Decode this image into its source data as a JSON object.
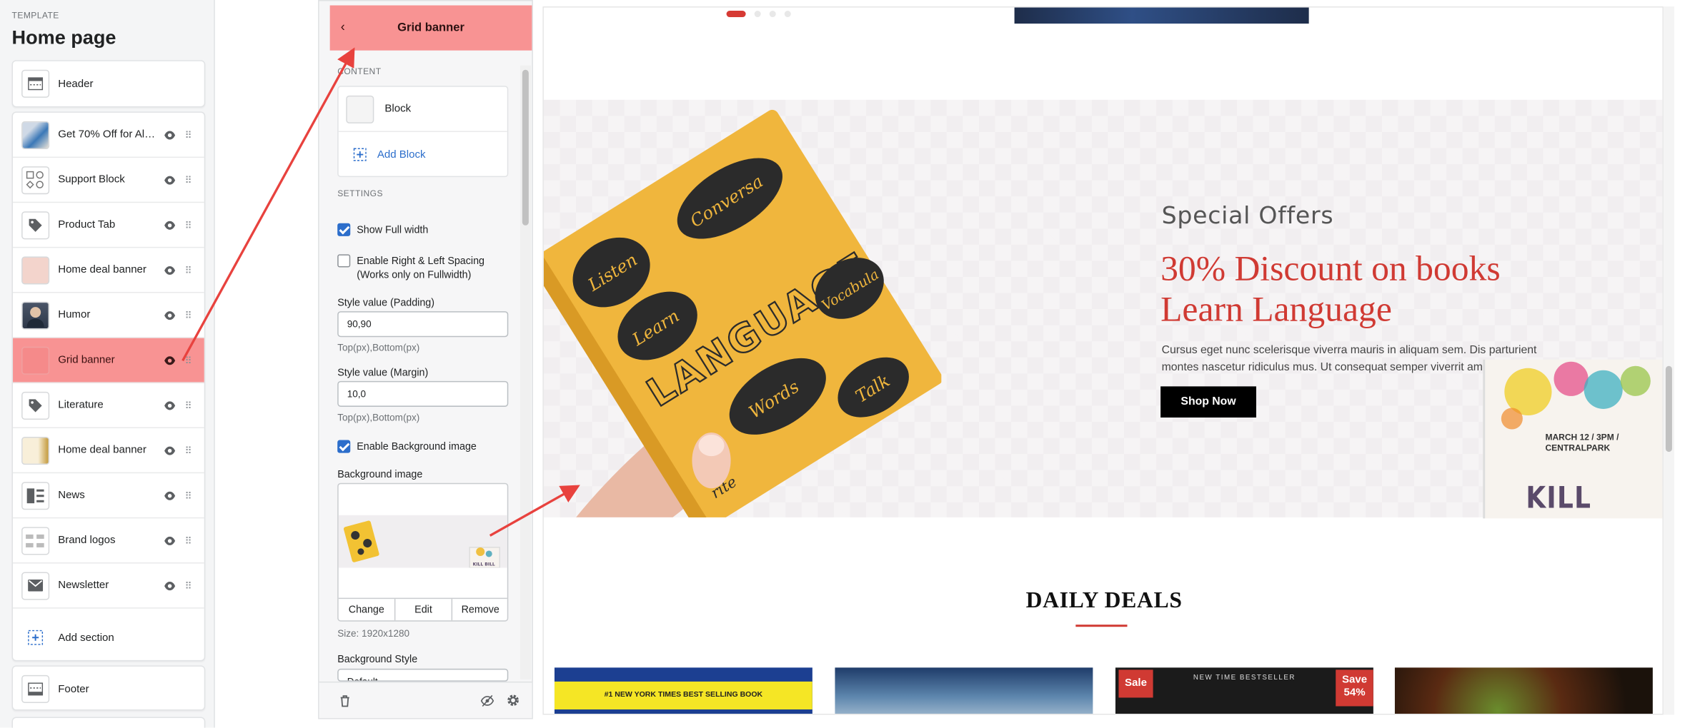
{
  "left_panel": {
    "template_label": "TEMPLATE",
    "page_title": "Home page",
    "header_label": "Header",
    "sections": [
      {
        "label": "Get 70% Off for All ...",
        "icon": "image-thumb"
      },
      {
        "label": "Support Block",
        "icon": "support-icons-thumb"
      },
      {
        "label": "Product Tab",
        "icon": "tag-icon"
      },
      {
        "label": "Home deal banner",
        "icon": "image-thumb"
      },
      {
        "label": "Humor",
        "icon": "portrait-thumb"
      },
      {
        "label": "Grid banner",
        "icon": "image-thumb",
        "active": true
      },
      {
        "label": "Literature",
        "icon": "tag-icon"
      },
      {
        "label": "Home deal banner",
        "icon": "image-thumb"
      },
      {
        "label": "News",
        "icon": "news-icon"
      },
      {
        "label": "Brand logos",
        "icon": "logos-thumb"
      },
      {
        "label": "Newsletter",
        "icon": "mail-icon"
      }
    ],
    "add_section_label": "Add section",
    "footer_label": "Footer"
  },
  "settings": {
    "title": "Grid banner",
    "content_caption": "CONTENT",
    "block_label": "Block",
    "add_block_label": "Add Block",
    "settings_caption": "SETTINGS",
    "show_full_width": {
      "label": "Show Full width",
      "checked": true
    },
    "enable_spacing": {
      "label_1": "Enable Right & Left Spacing",
      "label_2": "(Works only on Fullwidth)",
      "checked": false
    },
    "padding": {
      "label": "Style value (Padding)",
      "value": "90,90",
      "hint": "Top(px),Bottom(px)"
    },
    "margin": {
      "label": "Style value (Margin)",
      "value": "10,0",
      "hint": "Top(px),Bottom(px)"
    },
    "enable_bg": {
      "label": "Enable Background image",
      "checked": true
    },
    "bg_image_label": "Background image",
    "buttons": {
      "change": "Change",
      "edit": "Edit",
      "remove": "Remove"
    },
    "size_text": "Size: 1920x1280",
    "bg_style_label": "Background Style",
    "bg_style_value": "Default"
  },
  "preview": {
    "special_offers": "Special Offers",
    "headline_1": "30% Discount on books",
    "headline_2": "Learn Language",
    "paragraph": "Cursus eget nunc scelerisque viverra mauris in aliquam sem. Dis parturient montes nascetur ridiculus mus. Ut consequat semper viverrit amet",
    "shop_now": "Shop Now",
    "poster_date_1": "MARCH 12 / 3PM /",
    "poster_date_2": "CENTRALPARK",
    "poster_title": "KILL BILL",
    "book_title": "LANGUAGE",
    "bubble_words": [
      "Listen",
      "Conversa",
      "Learn",
      "Words",
      "Talk",
      "Vocabula",
      "rite"
    ],
    "daily_deals": "DAILY DEALS",
    "card1_text": "#1 NEW YORK TIMES BEST SELLING BOOK",
    "card3_text": "NEW TIME BESTSELLER",
    "sale_badge": "Sale",
    "save_badge_1": "Save",
    "save_badge_2": "54%"
  },
  "colors": {
    "highlight": "#f89393",
    "accent_red": "#d03a33",
    "link_blue": "#2c6ecb",
    "annotation_arrow": "#e8423e"
  }
}
